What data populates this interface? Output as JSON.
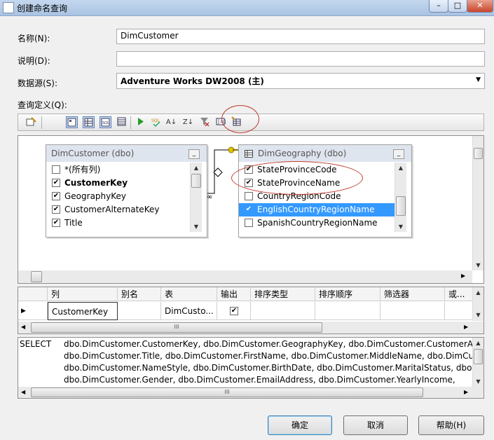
{
  "window": {
    "title": "创建命名查询",
    "controls": [
      "–",
      "□",
      "✕"
    ]
  },
  "form": {
    "name_label": "名称(N):",
    "name_value": "DimCustomer",
    "desc_label": "说明(D):",
    "desc_value": "",
    "source_label": "数据源(S):",
    "source_value": "Adventure Works DW2008 (主)",
    "query_label": "查询定义(Q):"
  },
  "toolbar": {
    "buttons": [
      "diagram-pane-icon",
      "show-diagram-icon",
      "show-grid-icon",
      "show-sql-icon",
      "show-results-icon",
      "run-icon",
      "verify-sql-icon",
      "sort-ascending-icon",
      "sort-descending-icon",
      "remove-filter-icon",
      "group-by-icon",
      "add-table-icon"
    ],
    "sort_asc_glyph": "A↓",
    "sort_desc_glyph": "Z↓"
  },
  "diagram": {
    "tables": [
      {
        "title": "DimCustomer (dbo)",
        "rows": [
          {
            "label": "*(所有列)",
            "checked": false,
            "bold": false
          },
          {
            "label": "CustomerKey",
            "checked": true,
            "bold": true
          },
          {
            "label": "GeographyKey",
            "checked": true,
            "bold": false
          },
          {
            "label": "CustomerAlternateKey",
            "checked": true,
            "bold": false
          },
          {
            "label": "Title",
            "checked": true,
            "bold": false
          }
        ]
      },
      {
        "title": "DimGeography (dbo)",
        "rows": [
          {
            "label": "StateProvinceCode",
            "checked": true,
            "selected": false
          },
          {
            "label": "StateProvinceName",
            "checked": true,
            "selected": false
          },
          {
            "label": "CountryRegionCode",
            "checked": false,
            "selected": false
          },
          {
            "label": "EnglishCountryRegionName",
            "checked": true,
            "selected": true
          },
          {
            "label": "SpanishCountryRegionName",
            "checked": false,
            "selected": false
          }
        ]
      }
    ]
  },
  "grid": {
    "headers": [
      "列",
      "别名",
      "表",
      "输出",
      "排序类型",
      "排序顺序",
      "筛选器",
      "或..."
    ],
    "rows": [
      {
        "column": "CustomerKey",
        "alias": "",
        "table": "DimCusto...",
        "output": true
      }
    ]
  },
  "sql": {
    "keyword": "SELECT",
    "lines": [
      "dbo.DimCustomer.CustomerKey, dbo.DimCustomer.GeographyKey, dbo.DimCustomer.CustomerAltern",
      "dbo.DimCustomer.Title, dbo.DimCustomer.FirstName, dbo.DimCustomer.MiddleName, dbo.DimCust",
      "dbo.DimCustomer.NameStyle, dbo.DimCustomer.BirthDate, dbo.DimCustomer.MaritalStatus, dbo.Di",
      "dbo.DimCustomer.Gender, dbo.DimCustomer.EmailAddress, dbo.DimCustomer.YearlyIncome,"
    ]
  },
  "buttons": {
    "ok": "确定",
    "cancel": "取消",
    "help": "帮助(H)"
  },
  "scroll": {
    "grip": "III"
  },
  "colors": {
    "selection": "#3399ff",
    "annotation": "#c0392b"
  }
}
